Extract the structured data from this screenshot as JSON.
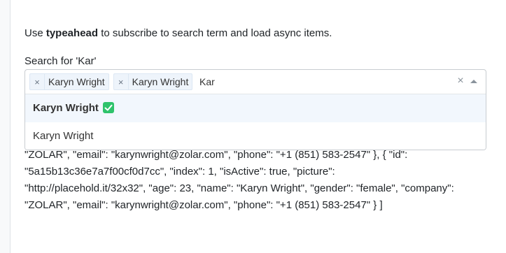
{
  "intro": {
    "prefix": "Use ",
    "keyword": "typeahead",
    "suffix": " to subscribe to search term and load async items."
  },
  "search": {
    "label": "Search for 'Kar'",
    "input_value": "Kar",
    "selected": [
      {
        "remove_glyph": "×",
        "label": "Karyn Wright"
      },
      {
        "remove_glyph": "×",
        "label": "Karyn Wright"
      }
    ],
    "clear_glyph": "×"
  },
  "dropdown": {
    "options": [
      {
        "label": "Karyn Wright",
        "selected": true
      },
      {
        "label": "Karyn Wright",
        "selected": false
      }
    ]
  },
  "results": {
    "lines": [
      "\"ZOLAR\", \"email\": \"karynwright@zolar.com\", \"phone\": \"+1 (851) 583-2547\" }, { \"id\":",
      "\"5a15b13c36e7a7f00cf0d7cc\", \"index\": 1, \"isActive\": true, \"picture\":",
      "\"http://placehold.it/32x32\", \"age\": 23, \"name\": \"Karyn Wright\", \"gender\": \"female\", \"company\":",
      "\"ZOLAR\", \"email\": \"karynwright@zolar.com\", \"phone\": \"+1 (851) 583-2547\" } ]"
    ]
  },
  "colors": {
    "accent_check": "#2fc36b",
    "chip_bg": "#eef4fb",
    "option_highlight": "#f2f7fd"
  }
}
